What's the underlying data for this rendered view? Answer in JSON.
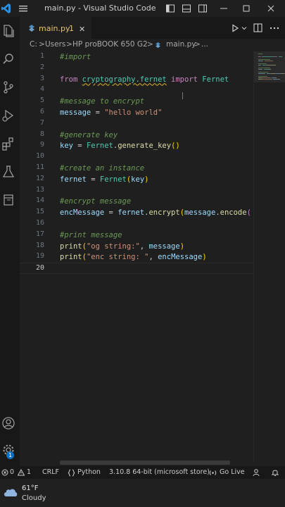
{
  "window": {
    "title": "main.py - Visual Studio Code"
  },
  "tab": {
    "name": "main.py",
    "problem_count": "1",
    "close": "✕"
  },
  "breadcrumb": {
    "parts": [
      "C:",
      ">",
      "Users",
      ">",
      "HP  proBOOK 650 G2",
      ">",
      "main.py",
      ">",
      "..."
    ]
  },
  "editor": {
    "lines": [
      {
        "n": "1",
        "tokens": [
          {
            "t": "#import",
            "k": "com"
          }
        ]
      },
      {
        "n": "2",
        "tokens": []
      },
      {
        "n": "3",
        "tokens": [
          {
            "t": "from ",
            "k": "kw"
          },
          {
            "t": "cryptography.fernet",
            "k": "mod"
          },
          {
            "t": " import ",
            "k": "kw"
          },
          {
            "t": "Fernet",
            "k": "mod"
          }
        ]
      },
      {
        "n": "4",
        "tokens": []
      },
      {
        "n": "5",
        "tokens": [
          {
            "t": "#message to encrypt",
            "k": "com"
          }
        ]
      },
      {
        "n": "6",
        "tokens": [
          {
            "t": "message",
            "k": "var"
          },
          {
            "t": " = ",
            "k": "plain"
          },
          {
            "t": "\"hello world\"",
            "k": "str"
          }
        ]
      },
      {
        "n": "7",
        "tokens": []
      },
      {
        "n": "8",
        "tokens": [
          {
            "t": "#generate key",
            "k": "com"
          }
        ]
      },
      {
        "n": "9",
        "tokens": [
          {
            "t": "key",
            "k": "var"
          },
          {
            "t": " = ",
            "k": "plain"
          },
          {
            "t": "Fernet",
            "k": "mod"
          },
          {
            "t": ".",
            "k": "plain"
          },
          {
            "t": "generate_key",
            "k": "fn"
          },
          {
            "t": "()",
            "k": "brk1"
          }
        ]
      },
      {
        "n": "10",
        "tokens": []
      },
      {
        "n": "11",
        "tokens": [
          {
            "t": "#create an instance",
            "k": "com"
          }
        ]
      },
      {
        "n": "12",
        "tokens": [
          {
            "t": "fernet",
            "k": "var"
          },
          {
            "t": " = ",
            "k": "plain"
          },
          {
            "t": "Fernet",
            "k": "mod"
          },
          {
            "t": "(",
            "k": "brk1"
          },
          {
            "t": "key",
            "k": "var"
          },
          {
            "t": ")",
            "k": "brk1"
          }
        ]
      },
      {
        "n": "13",
        "tokens": []
      },
      {
        "n": "14",
        "tokens": [
          {
            "t": "#encrypt message",
            "k": "com"
          }
        ]
      },
      {
        "n": "15",
        "tokens": [
          {
            "t": "encMessage",
            "k": "var"
          },
          {
            "t": " = ",
            "k": "plain"
          },
          {
            "t": "fernet",
            "k": "var"
          },
          {
            "t": ".",
            "k": "plain"
          },
          {
            "t": "encrypt",
            "k": "fn"
          },
          {
            "t": "(",
            "k": "brk1"
          },
          {
            "t": "message",
            "k": "var"
          },
          {
            "t": ".",
            "k": "plain"
          },
          {
            "t": "encode",
            "k": "fn"
          },
          {
            "t": "(",
            "k": "brk2"
          }
        ]
      },
      {
        "n": "16",
        "tokens": []
      },
      {
        "n": "17",
        "tokens": [
          {
            "t": "#print message",
            "k": "com"
          }
        ]
      },
      {
        "n": "18",
        "tokens": [
          {
            "t": "print",
            "k": "fn"
          },
          {
            "t": "(",
            "k": "brk1"
          },
          {
            "t": "\"og string:\"",
            "k": "str"
          },
          {
            "t": ", ",
            "k": "plain"
          },
          {
            "t": "message",
            "k": "var"
          },
          {
            "t": ")",
            "k": "brk1"
          }
        ]
      },
      {
        "n": "19",
        "tokens": [
          {
            "t": "print",
            "k": "fn"
          },
          {
            "t": "(",
            "k": "brk1"
          },
          {
            "t": "\"enc string: \"",
            "k": "str"
          },
          {
            "t": ", ",
            "k": "plain"
          },
          {
            "t": "encMessage",
            "k": "var"
          },
          {
            "t": ")",
            "k": "brk1"
          }
        ]
      },
      {
        "n": "20",
        "tokens": []
      }
    ]
  },
  "statusbar": {
    "errors": "0",
    "warnings": "1",
    "eol": "CRLF",
    "language": "Python",
    "interpreter": "3.10.8 64-bit (microsoft store)",
    "golive": "Go Live"
  },
  "taskbar": {
    "temperature": "61°F",
    "condition": "Cloudy"
  },
  "activity_badge": "1",
  "colors": {
    "comment": "#6a9955",
    "keyword": "#c586c0",
    "module": "#4ec9b0",
    "string": "#ce9178",
    "variable": "#9cdcfe",
    "function": "#dcdcaa",
    "tab_modified": "#e8c46c"
  }
}
